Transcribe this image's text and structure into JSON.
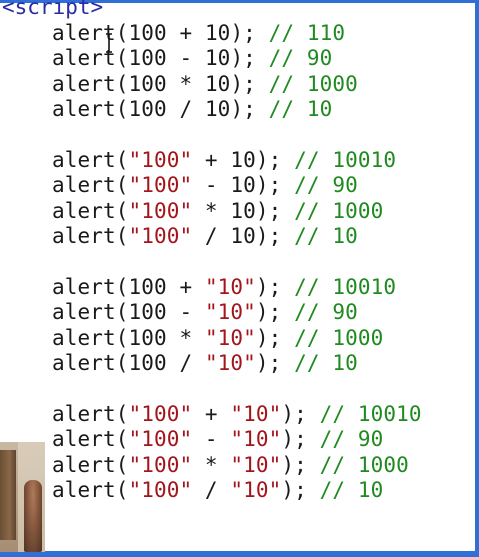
{
  "editor": {
    "open_tag": "<script>",
    "blocks": [
      {
        "lines": [
          {
            "parts": [
              {
                "t": "fn",
                "v": "alert"
              },
              {
                "t": "punc",
                "v": "("
              },
              {
                "t": "num",
                "v": "100"
              },
              {
                "t": "op",
                "v": " + "
              },
              {
                "t": "num",
                "v": "10"
              },
              {
                "t": "punc",
                "v": "); "
              },
              {
                "t": "comment",
                "v": "// 110"
              }
            ]
          },
          {
            "parts": [
              {
                "t": "fn",
                "v": "alert"
              },
              {
                "t": "punc",
                "v": "("
              },
              {
                "t": "num",
                "v": "100"
              },
              {
                "t": "op",
                "v": " - "
              },
              {
                "t": "num",
                "v": "10"
              },
              {
                "t": "punc",
                "v": "); "
              },
              {
                "t": "comment",
                "v": "// 90"
              }
            ]
          },
          {
            "parts": [
              {
                "t": "fn",
                "v": "alert"
              },
              {
                "t": "punc",
                "v": "("
              },
              {
                "t": "num",
                "v": "100"
              },
              {
                "t": "op",
                "v": " * "
              },
              {
                "t": "num",
                "v": "10"
              },
              {
                "t": "punc",
                "v": "); "
              },
              {
                "t": "comment",
                "v": "// 1000"
              }
            ]
          },
          {
            "parts": [
              {
                "t": "fn",
                "v": "alert"
              },
              {
                "t": "punc",
                "v": "("
              },
              {
                "t": "num",
                "v": "100"
              },
              {
                "t": "op",
                "v": " / "
              },
              {
                "t": "num",
                "v": "10"
              },
              {
                "t": "punc",
                "v": "); "
              },
              {
                "t": "comment",
                "v": "// 10"
              }
            ]
          }
        ]
      },
      {
        "lines": [
          {
            "parts": [
              {
                "t": "fn",
                "v": "alert"
              },
              {
                "t": "punc",
                "v": "("
              },
              {
                "t": "str",
                "v": "\"100\""
              },
              {
                "t": "op",
                "v": " + "
              },
              {
                "t": "num",
                "v": "10"
              },
              {
                "t": "punc",
                "v": "); "
              },
              {
                "t": "comment",
                "v": "// 10010"
              }
            ]
          },
          {
            "parts": [
              {
                "t": "fn",
                "v": "alert"
              },
              {
                "t": "punc",
                "v": "("
              },
              {
                "t": "str",
                "v": "\"100\""
              },
              {
                "t": "op",
                "v": " - "
              },
              {
                "t": "num",
                "v": "10"
              },
              {
                "t": "punc",
                "v": "); "
              },
              {
                "t": "comment",
                "v": "// 90"
              }
            ]
          },
          {
            "parts": [
              {
                "t": "fn",
                "v": "alert"
              },
              {
                "t": "punc",
                "v": "("
              },
              {
                "t": "str",
                "v": "\"100\""
              },
              {
                "t": "op",
                "v": " * "
              },
              {
                "t": "num",
                "v": "10"
              },
              {
                "t": "punc",
                "v": "); "
              },
              {
                "t": "comment",
                "v": "// 1000"
              }
            ]
          },
          {
            "parts": [
              {
                "t": "fn",
                "v": "alert"
              },
              {
                "t": "punc",
                "v": "("
              },
              {
                "t": "str",
                "v": "\"100\""
              },
              {
                "t": "op",
                "v": " / "
              },
              {
                "t": "num",
                "v": "10"
              },
              {
                "t": "punc",
                "v": "); "
              },
              {
                "t": "comment",
                "v": "// 10"
              }
            ]
          }
        ]
      },
      {
        "lines": [
          {
            "parts": [
              {
                "t": "fn",
                "v": "alert"
              },
              {
                "t": "punc",
                "v": "("
              },
              {
                "t": "num",
                "v": "100"
              },
              {
                "t": "op",
                "v": " + "
              },
              {
                "t": "str",
                "v": "\"10\""
              },
              {
                "t": "punc",
                "v": "); "
              },
              {
                "t": "comment",
                "v": "// 10010"
              }
            ]
          },
          {
            "parts": [
              {
                "t": "fn",
                "v": "alert"
              },
              {
                "t": "punc",
                "v": "("
              },
              {
                "t": "num",
                "v": "100"
              },
              {
                "t": "op",
                "v": " - "
              },
              {
                "t": "str",
                "v": "\"10\""
              },
              {
                "t": "punc",
                "v": "); "
              },
              {
                "t": "comment",
                "v": "// 90"
              }
            ]
          },
          {
            "parts": [
              {
                "t": "fn",
                "v": "alert"
              },
              {
                "t": "punc",
                "v": "("
              },
              {
                "t": "num",
                "v": "100"
              },
              {
                "t": "op",
                "v": " * "
              },
              {
                "t": "str",
                "v": "\"10\""
              },
              {
                "t": "punc",
                "v": "); "
              },
              {
                "t": "comment",
                "v": "// 1000"
              }
            ]
          },
          {
            "parts": [
              {
                "t": "fn",
                "v": "alert"
              },
              {
                "t": "punc",
                "v": "("
              },
              {
                "t": "num",
                "v": "100"
              },
              {
                "t": "op",
                "v": " / "
              },
              {
                "t": "str",
                "v": "\"10\""
              },
              {
                "t": "punc",
                "v": "); "
              },
              {
                "t": "comment",
                "v": "// 10"
              }
            ]
          }
        ]
      },
      {
        "lines": [
          {
            "parts": [
              {
                "t": "fn",
                "v": "alert"
              },
              {
                "t": "punc",
                "v": "("
              },
              {
                "t": "str",
                "v": "\"100\""
              },
              {
                "t": "op",
                "v": " + "
              },
              {
                "t": "str",
                "v": "\"10\""
              },
              {
                "t": "punc",
                "v": "); "
              },
              {
                "t": "comment",
                "v": "// 10010"
              }
            ]
          },
          {
            "parts": [
              {
                "t": "fn",
                "v": "alert"
              },
              {
                "t": "punc",
                "v": "("
              },
              {
                "t": "str",
                "v": "\"100\""
              },
              {
                "t": "op",
                "v": " - "
              },
              {
                "t": "str",
                "v": "\"10\""
              },
              {
                "t": "punc",
                "v": "); "
              },
              {
                "t": "comment",
                "v": "// 90"
              }
            ]
          },
          {
            "parts": [
              {
                "t": "fn",
                "v": "alert"
              },
              {
                "t": "punc",
                "v": "("
              },
              {
                "t": "str",
                "v": "\"100\""
              },
              {
                "t": "op",
                "v": " * "
              },
              {
                "t": "str",
                "v": "\"10\""
              },
              {
                "t": "punc",
                "v": "); "
              },
              {
                "t": "comment",
                "v": "// 1000"
              }
            ]
          },
          {
            "parts": [
              {
                "t": "fn",
                "v": "alert"
              },
              {
                "t": "punc",
                "v": "("
              },
              {
                "t": "str",
                "v": "\"100\""
              },
              {
                "t": "op",
                "v": " / "
              },
              {
                "t": "str",
                "v": "\"10\""
              },
              {
                "t": "punc",
                "v": "); "
              },
              {
                "t": "comment",
                "v": "// 10"
              }
            ]
          }
        ]
      }
    ]
  },
  "colors": {
    "keyword_tag": "#2a2aa3",
    "string": "#a3151d",
    "comment": "#1f8a1f",
    "text": "#1a1a1a",
    "accent_bar": "#2f6fd6"
  },
  "icons": {
    "cursor": "text-cursor-icon",
    "webcam": "webcam-overlay"
  }
}
